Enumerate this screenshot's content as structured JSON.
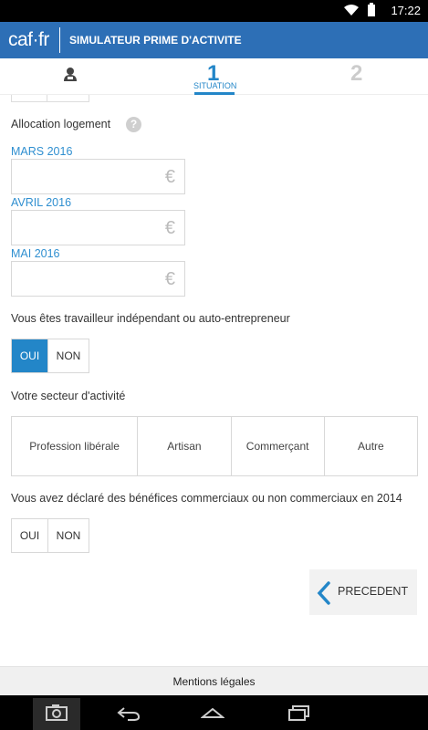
{
  "status": {
    "time": "17:22"
  },
  "header": {
    "logo": "caf·fr",
    "title": "SIMULATEUR PRIME D'ACTIVITE"
  },
  "steps": {
    "step1": "1",
    "step1_label": "SITUATION",
    "step2": "2"
  },
  "form": {
    "housing_label": "Allocation logement",
    "help_icon": "?",
    "months": [
      {
        "label": "MARS 2016",
        "value": "",
        "currency": "€"
      },
      {
        "label": "AVRIL 2016",
        "value": "",
        "currency": "€"
      },
      {
        "label": "MAI 2016",
        "value": "",
        "currency": "€"
      }
    ],
    "independent_question": "Vous êtes travailleur indépendant ou auto-entrepreneur",
    "independent_options": {
      "yes": "OUI",
      "no": "NON"
    },
    "sector_label": "Votre secteur d'activité",
    "sectors": [
      "Profession libérale",
      "Artisan",
      "Commerçant",
      "Autre"
    ],
    "benefits_question": "Vous avez déclaré des bénéfices commerciaux ou non commerciaux en 2014",
    "benefits_options": {
      "yes": "OUI",
      "no": "NON"
    }
  },
  "actions": {
    "previous": "PRECEDENT"
  },
  "footer": {
    "legal": "Mentions légales"
  },
  "colors": {
    "brand": "#2d6fb6",
    "accent": "#2386c8"
  }
}
